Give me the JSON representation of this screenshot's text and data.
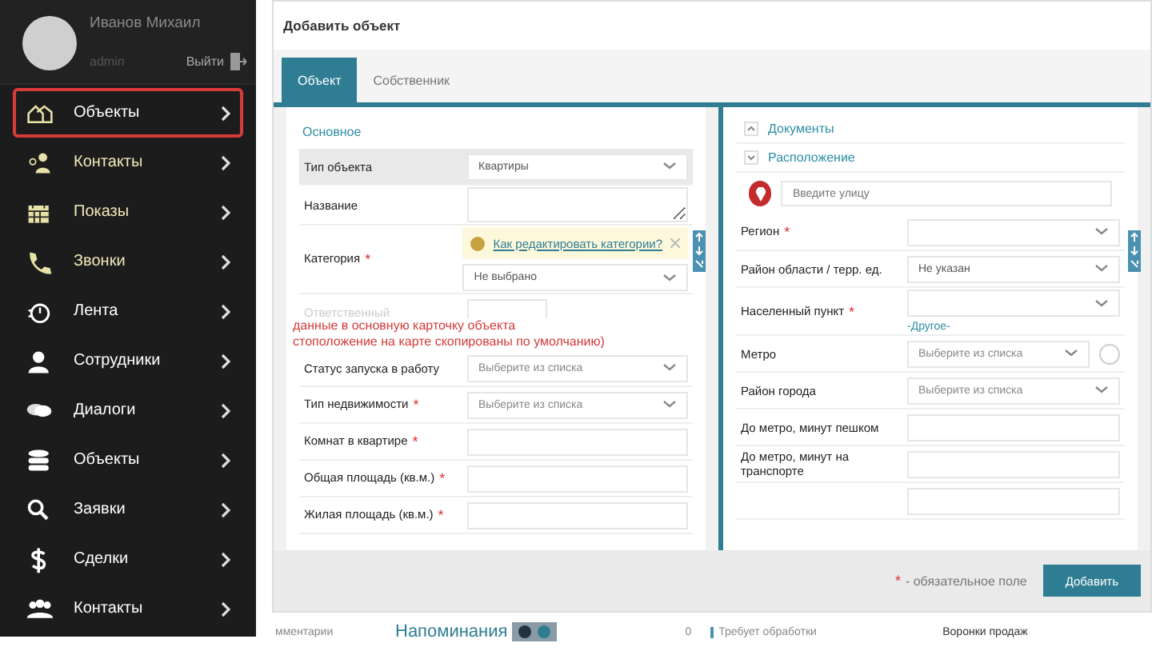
{
  "user": {
    "name": "Иванов Михаил",
    "role": "admin",
    "logout": "Выйти"
  },
  "menu": [
    {
      "label": "Объекты",
      "kind": "houses",
      "highlighted": false,
      "selected": true
    },
    {
      "label": "Контакты",
      "kind": "people",
      "highlighted": true,
      "selected": false
    },
    {
      "label": "Показы",
      "kind": "calendar",
      "highlighted": true,
      "selected": false
    },
    {
      "label": "Звонки",
      "kind": "phone",
      "highlighted": true,
      "selected": false
    },
    {
      "label": "Лента",
      "kind": "stopwatch",
      "highlighted": false,
      "selected": false
    },
    {
      "label": "Сотрудники",
      "kind": "person",
      "highlighted": false,
      "selected": false
    },
    {
      "label": "Диалоги",
      "kind": "chat",
      "highlighted": false,
      "selected": false
    },
    {
      "label": "Объекты",
      "kind": "database",
      "highlighted": false,
      "selected": false
    },
    {
      "label": "Заявки",
      "kind": "search",
      "highlighted": false,
      "selected": false
    },
    {
      "label": "Сделки",
      "kind": "dollar",
      "highlighted": false,
      "selected": false
    },
    {
      "label": "Контакты",
      "kind": "group",
      "highlighted": false,
      "selected": false
    }
  ],
  "dialog": {
    "title": "Добавить объект",
    "tabs": [
      {
        "label": "Объект",
        "selected": true
      },
      {
        "label": "Собственник",
        "selected": false
      }
    ],
    "left": {
      "heading": "Основное",
      "rows": [
        {
          "label": "Тип объекта",
          "kind": "select",
          "value": "Квартиры",
          "selected": true,
          "disabled": false
        },
        {
          "label": "Название",
          "kind": "textarea",
          "selected": false,
          "disabled": false
        },
        {
          "label": "Категория",
          "kind": "select",
          "value": "Не выбрано",
          "mark": "*",
          "selected": false,
          "disabled": false,
          "tip": "Как редактировать категории?"
        },
        {
          "label": "Ответственный",
          "kind": "text",
          "selected": false,
          "disabled": true
        },
        {
          "label": "Статус запуска в работу",
          "kind": "select",
          "placeholder": "Выберите из списка",
          "selected": false,
          "disabled": false
        },
        {
          "label": "Тип недвижимости",
          "kind": "select",
          "placeholder": "Выберите из списка",
          "mark": "*",
          "selected": false,
          "disabled": false
        },
        {
          "label": "Комнат в квартире",
          "kind": "text",
          "mark": "*",
          "selected": false,
          "disabled": false
        },
        {
          "label": "Общая площадь (кв.м.)",
          "kind": "text",
          "mark": "*",
          "selected": false,
          "disabled": false
        },
        {
          "label": "Жилая площадь (кв.м.)",
          "kind": "text",
          "mark": "*",
          "selected": false,
          "disabled": false
        }
      ]
    },
    "overlay_note": [
      "данные в основную карточку объекта",
      "стоположение на карте скопированы по умолчанию)"
    ],
    "sections": [
      {
        "title": "Документы",
        "expanded": false
      },
      {
        "title": "Расположение",
        "expanded": true
      }
    ],
    "street": {
      "placeholder": "Введите улицу"
    },
    "right_rows": [
      {
        "label": "Регион",
        "kind": "select",
        "mark": "*"
      },
      {
        "label": "Район области / терр. ед.",
        "kind": "select",
        "value": "Не указан"
      },
      {
        "label": "Населенный пункт",
        "kind": "select",
        "mark": "*",
        "link": "-Другое-"
      },
      {
        "label": "Метро",
        "kind": "select",
        "placeholder": "Выберите из списка",
        "extra": true
      },
      {
        "label": "Район города",
        "kind": "select",
        "placeholder": "Выберите из списка"
      },
      {
        "label": "До метро, минут пешком",
        "kind": "text"
      },
      {
        "label": "До метро, минут на транспорте",
        "kind": "text"
      },
      {
        "kind": "blank"
      }
    ],
    "footer": {
      "mark": "*",
      "note": "- обязательное поле",
      "button": "Добавить"
    }
  },
  "background": {
    "cells": [
      "мментарии",
      "Напоминания",
      "0",
      "Требует обработки",
      "Воронки продаж"
    ]
  }
}
